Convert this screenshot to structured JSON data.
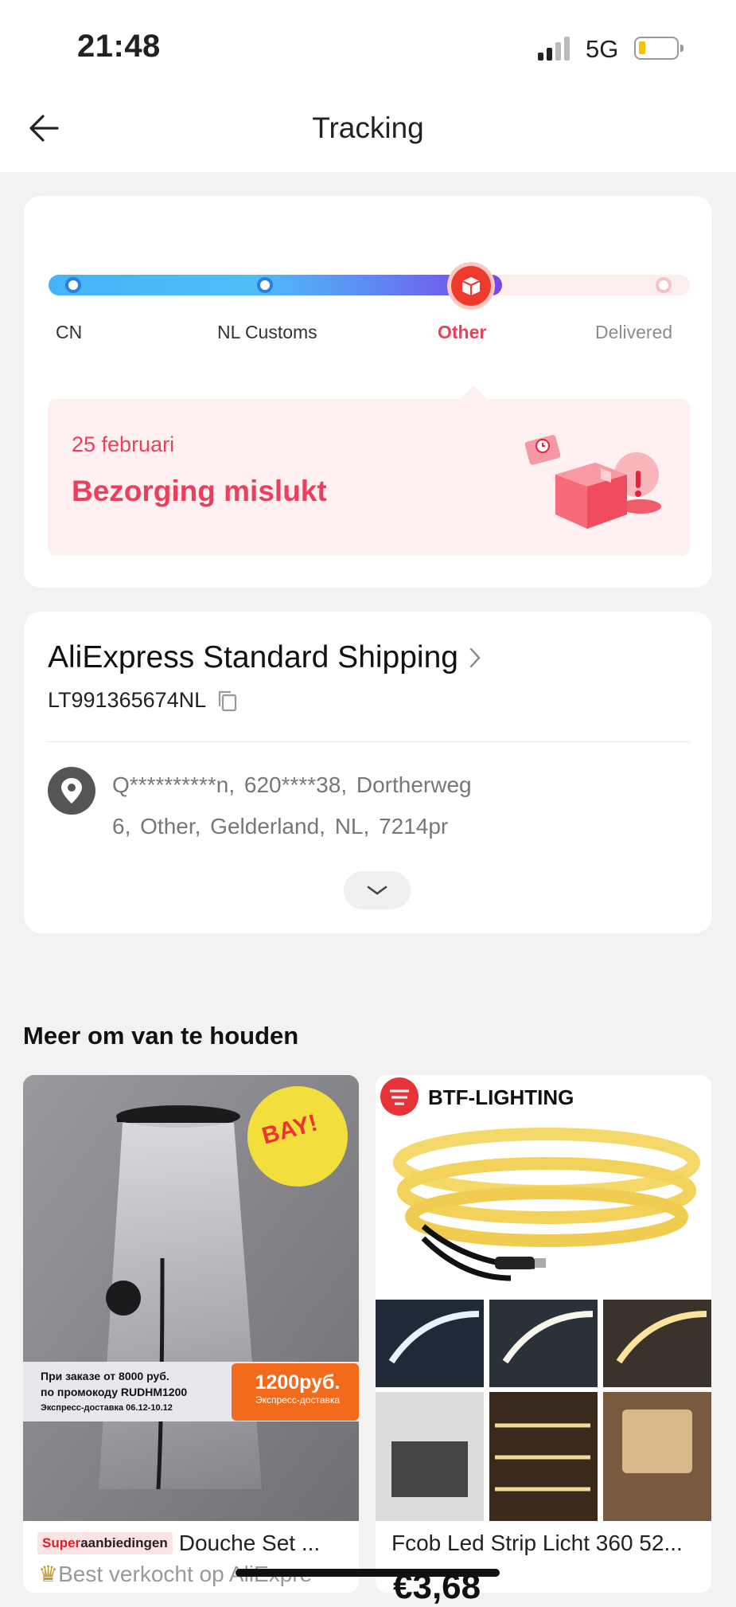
{
  "status_bar": {
    "time": "21:48",
    "network": "5G",
    "battery_color": "#f5c400"
  },
  "nav": {
    "title": "Tracking"
  },
  "progress": {
    "steps": [
      {
        "label": "CN",
        "state": "done"
      },
      {
        "label": "NL Customs",
        "state": "done"
      },
      {
        "label": "Other",
        "state": "current"
      },
      {
        "label": "Delivered",
        "state": "pending"
      }
    ],
    "status_date": "25 februari",
    "status_text": "Bezorging mislukt",
    "accent_color": "#ec3f5b"
  },
  "shipping": {
    "method": "AliExpress Standard Shipping",
    "tracking_number": "LT991365674NL",
    "address_line1": "Q**********n,  620****38,  Dortherweg",
    "address_line2": "6,  Other,  Gelderland,  NL,  7214pr"
  },
  "recommendations": {
    "title": "Meer om van te houden",
    "products": [
      {
        "badge_red": "Super",
        "badge_dark": "aanbiedingen",
        "title": "Douche Set ...",
        "subtitle": "Best verkocht op AliExpre",
        "image_text": {
          "sticker": "BAY!",
          "promo_line1": "При заказе от 8000 руб.",
          "promo_line2": "по промокоду RUDHM1200",
          "promo_line3": "Экспресс-доставка 06.12-10.12",
          "promo_price": "1200руб.",
          "promo_price_sub": "Экспресс-доставка"
        }
      },
      {
        "title": "Fcob Led Strip Licht 360 52...",
        "price": "€3,68",
        "brand": "BTF-LIGHTING"
      }
    ]
  }
}
